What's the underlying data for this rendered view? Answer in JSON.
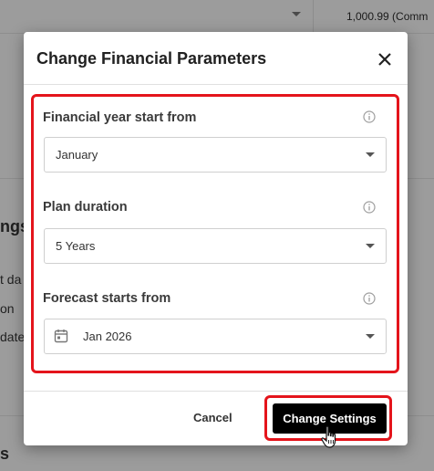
{
  "background": {
    "top_value": "1,000.99 (Comm",
    "heading": "ngs",
    "heading_bottom": "s",
    "rows": [
      "t da",
      "on",
      "date"
    ]
  },
  "dialog": {
    "title": "Change Financial Parameters",
    "fields": [
      {
        "label": "Financial year start from",
        "value": "January"
      },
      {
        "label": "Plan duration",
        "value": "5 Years"
      },
      {
        "label": "Forecast starts from",
        "value": "Jan 2026"
      }
    ],
    "cancel_label": "Cancel",
    "confirm_label": "Change Settings"
  },
  "icons": {
    "close": "close-icon",
    "info": "info-icon",
    "calendar": "calendar-icon",
    "cursor": "hand-cursor-icon"
  },
  "colors": {
    "highlight": "#e4141b",
    "primary_button": "#000000"
  }
}
